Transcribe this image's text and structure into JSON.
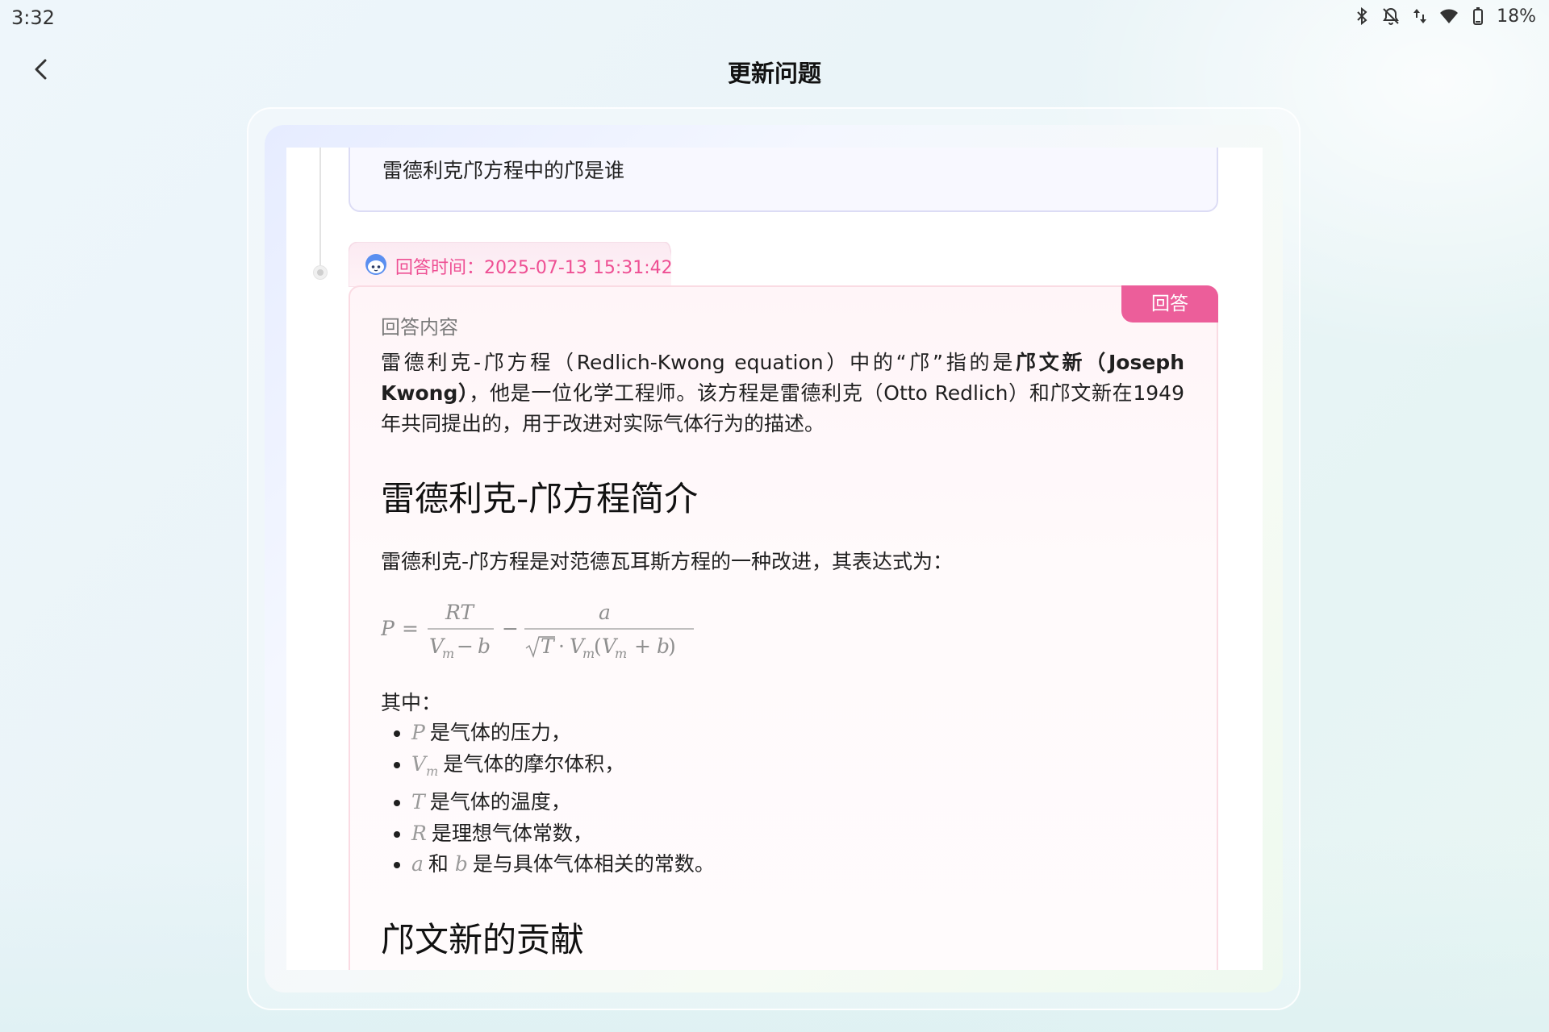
{
  "status_bar": {
    "time": "3:32",
    "battery": "18%",
    "icons": [
      "bluetooth-icon",
      "notifications-off-icon",
      "data-arrows-icon",
      "wifi-icon",
      "battery-icon"
    ]
  },
  "header": {
    "title": "更新问题",
    "back_icon": "chevron-left-icon"
  },
  "question": {
    "text": "雷德利克邝方程中的邝是谁"
  },
  "answer": {
    "time_label": "回答时间：2025-07-13 15:31:42",
    "badge": "回答",
    "content_label": "回答内容",
    "intro_before": "雷德利克-邝方程（Redlich-Kwong        equation）中的“邝”指的是",
    "intro_bold": "邝文新（Joseph Kwong）",
    "intro_after": "，他是一位化学工程师。该方程是雷德利克（Otto  Redlich）和邝文新在1949年共同提出的，用于改进对实际气体行为的描述。",
    "heading1": "雷德利克-邝方程简介",
    "para2": "雷德利克-邝方程是对范德瓦耳斯方程的一种改进，其表达式为：",
    "where_label": "其中：",
    "variables": [
      {
        "symbol": "P",
        "text": "是气体的压力，"
      },
      {
        "symbol": "V",
        "sub": "m",
        "text": "是气体的摩尔体积，"
      },
      {
        "symbol": "T",
        "text": "是气体的温度，"
      },
      {
        "symbol": "R",
        "text": "是理想气体常数，"
      },
      {
        "symbol": "a",
        "joiner": "和",
        "symbol2": "b",
        "text": "是与具体气体相关的常数。"
      }
    ],
    "heading2": "邝文新的贡献"
  },
  "colors": {
    "accent_pink": "#ec5e9a",
    "time_text": "#ee4f93",
    "question_border": "#dcdcf5",
    "answer_border": "#fadbe3"
  }
}
